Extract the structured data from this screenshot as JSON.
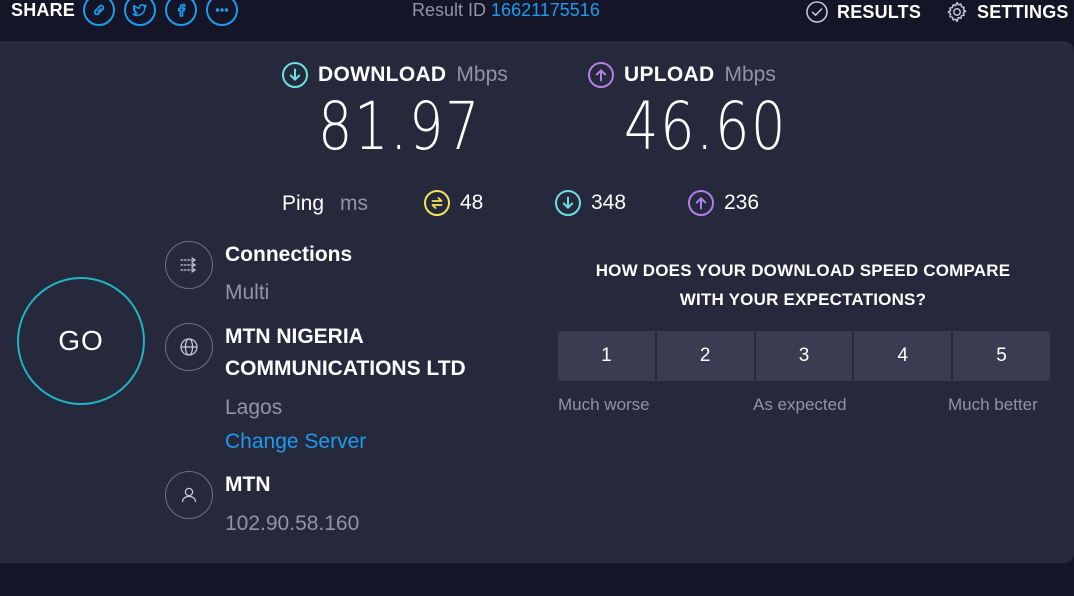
{
  "share": {
    "label": "SHARE",
    "icons": [
      "link-icon",
      "twitter-icon",
      "facebook-icon",
      "more-icon"
    ]
  },
  "result": {
    "label": "Result ID",
    "id": "16621175516"
  },
  "nav": {
    "results_label": "RESULTS",
    "settings_label": "SETTINGS"
  },
  "download": {
    "label": "DOWNLOAD",
    "unit": "Mbps",
    "value": "81.97"
  },
  "upload": {
    "label": "UPLOAD",
    "unit": "Mbps",
    "value": "46.60"
  },
  "ping": {
    "label": "Ping",
    "unit": "ms",
    "idle": "48",
    "download": "348",
    "upload": "236"
  },
  "go": {
    "label": "GO"
  },
  "connections": {
    "title": "Connections",
    "value": "Multi"
  },
  "server": {
    "name_line1": "MTN NIGERIA",
    "name_line2": "COMMUNICATIONS LTD",
    "location": "Lagos",
    "change_label": "Change Server"
  },
  "provider": {
    "name": "MTN",
    "ip": "102.90.58.160"
  },
  "survey": {
    "question_line1": "HOW DOES YOUR DOWNLOAD SPEED COMPARE",
    "question_line2": "WITH YOUR EXPECTATIONS?",
    "options": [
      "1",
      "2",
      "3",
      "4",
      "5"
    ],
    "low_label": "Much worse",
    "mid_label": "As expected",
    "high_label": "Much better"
  },
  "colors": {
    "accent_blue": "#1d9bf0",
    "download_cyan": "#6ce0df",
    "upload_purple": "#b57ee8",
    "ping_yellow": "#f6e35a",
    "go_ring": "#1fb5c3",
    "panel": "#26283b",
    "background": "#141526"
  }
}
